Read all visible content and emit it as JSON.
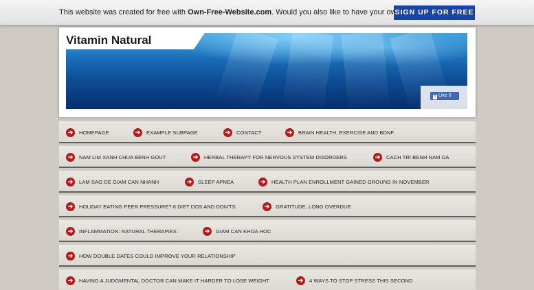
{
  "promo": {
    "text_before": "This website was created for free with ",
    "brand": "Own-Free-Website.com",
    "text_after": ". Would you also like to have your own website?",
    "signup_label": "SIGN UP FOR FREE"
  },
  "header": {
    "site_title": "Vitamin Natural",
    "like_label": "Like 0",
    "fb_glyph": "f"
  },
  "nav": {
    "arrow_glyph": "➔",
    "rows": [
      [
        "HOMEPAGE",
        "EXAMPLE SUBPAGE",
        "CONTACT",
        "BRAIN HEALTH, EXERCISE AND BDNF"
      ],
      [
        "NAM LIM XANH CHUA BENH GOUT",
        "HERBAL THERAPY FOR NERVOUS SYSTEM DISORDERS",
        "CACH TRI BENH NAM DA"
      ],
      [
        "LAM SAO DE GIAM CAN NHANH",
        "SLEEP APNEA",
        "HEALTH PLAN ENROLLMENT GAINED GROUND IN NOVEMBER"
      ],
      [
        "HOLIDAY EATING PEER PRESSURE? 6 DIET DOS AND DON'TS",
        "GRATITUDE, LONG OVERDUE"
      ],
      [
        "INFLAMMATION: NATURAL THERAPIES",
        "GIAM CAN KHOA HOC"
      ],
      [
        "HOW DOUBLE DATES COULD IMPROVE YOUR RELATIONSHIP"
      ],
      [
        "HAVING A JUDGMENTAL DOCTOR CAN MAKE IT HARDER TO LOSE WEIGHT",
        "4 WAYS TO STOP STRESS THIS SECOND"
      ]
    ]
  },
  "colors": {
    "promo_button": "#1a44a4",
    "arrow_icon": "#b51a1a",
    "page_background": "#cfcbc4"
  }
}
